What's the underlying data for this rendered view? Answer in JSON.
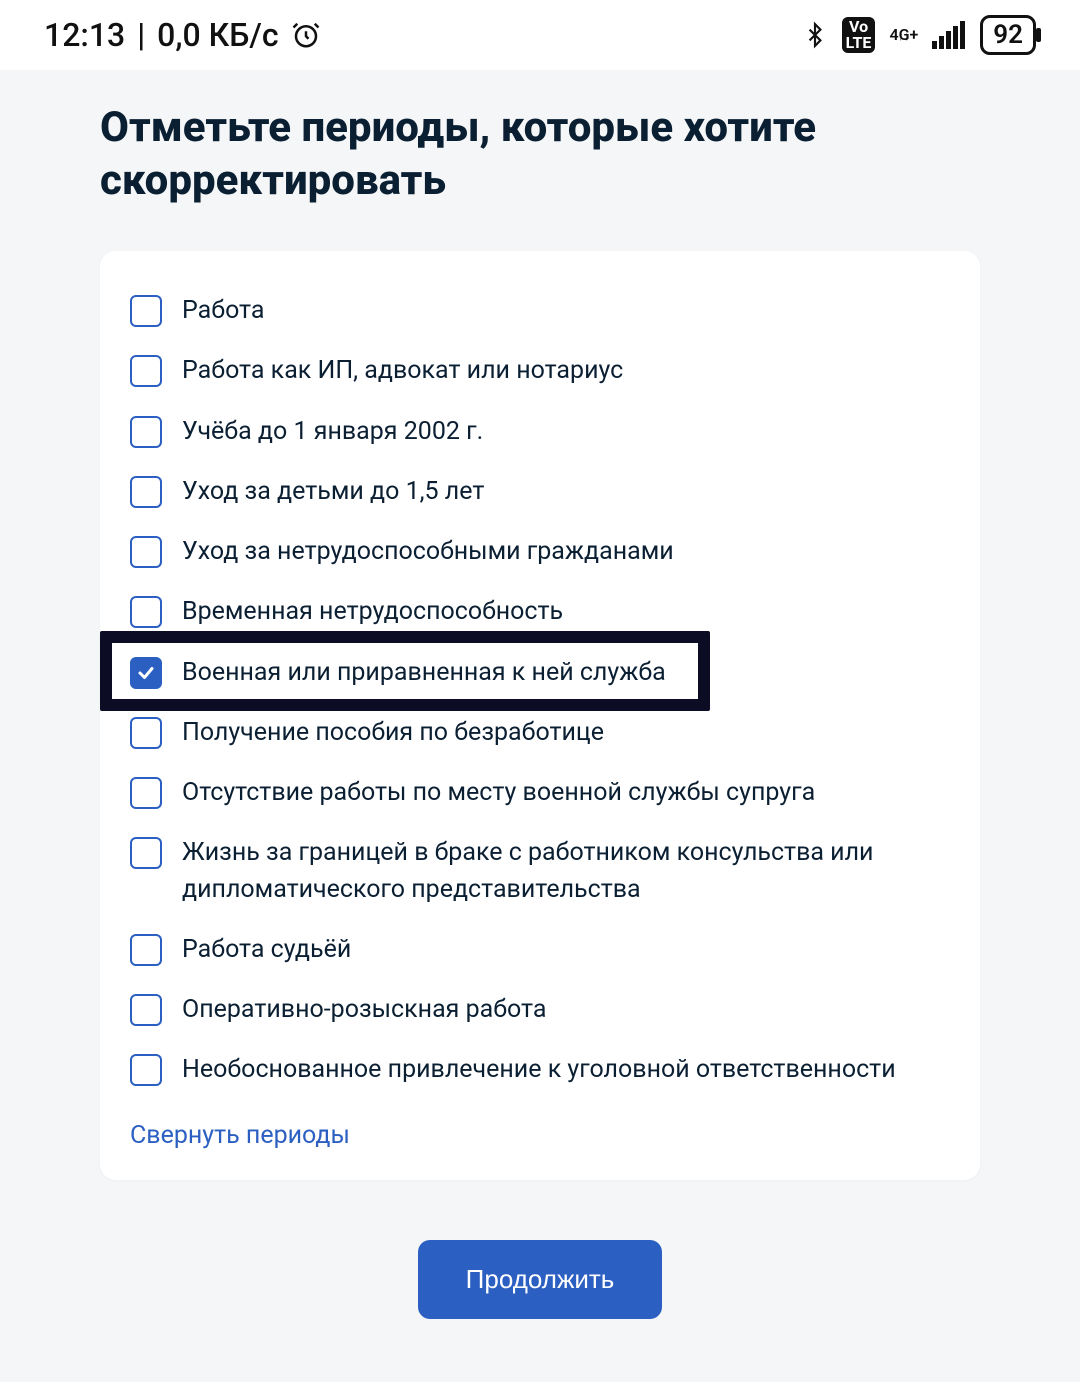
{
  "statusbar": {
    "time": "12:13",
    "data_rate": "0,0 КБ/с",
    "network_label": "4G+",
    "battery_percent": "92"
  },
  "heading": "Отметьте периоды, которые хотите скорректировать",
  "options": [
    {
      "label": "Работа",
      "checked": false
    },
    {
      "label": "Работа как ИП, адвокат или нотариус",
      "checked": false
    },
    {
      "label": "Учёба до 1 января 2002 г.",
      "checked": false
    },
    {
      "label": "Уход за детьми до 1,5 лет",
      "checked": false
    },
    {
      "label": "Уход за нетрудоспособными гражданами",
      "checked": false
    },
    {
      "label": "Временная нетрудоспособность",
      "checked": false
    },
    {
      "label": "Военная или приравненная к ней служба",
      "checked": true,
      "highlighted": true
    },
    {
      "label": "Получение пособия по безработице",
      "checked": false
    },
    {
      "label": "Отсутствие работы по месту военной службы супруга",
      "checked": false
    },
    {
      "label": "Жизнь за границей в браке с работником консульства или дипломатического представительства",
      "checked": false
    },
    {
      "label": "Работа судьёй",
      "checked": false
    },
    {
      "label": "Оперативно-розыскная работа",
      "checked": false
    },
    {
      "label": "Необоснованное привлечение к уголовной ответственности",
      "checked": false
    }
  ],
  "collapse_label": "Свернуть периоды",
  "continue_label": "Продолжить"
}
